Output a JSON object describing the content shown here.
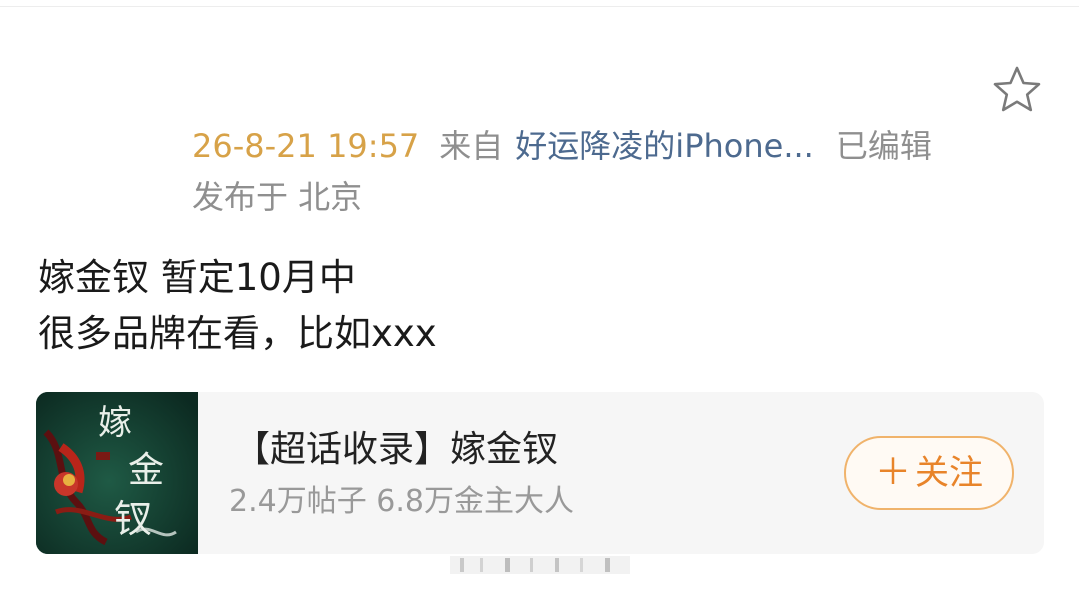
{
  "post_meta": {
    "time": "26-8-21 19:57",
    "from_label": "来自",
    "device": "好运降凌的iPhone...",
    "edited": "已编辑",
    "location": "发布于 北京"
  },
  "post": {
    "lines": [
      "嫁金钗 暂定10月中",
      "很多品牌在看，比如xxx"
    ]
  },
  "topic_card": {
    "title": "【超话收录】嫁金钗",
    "stats": "2.4万帖子 6.8万金主大人",
    "follow_label": "关注",
    "follow_icon": "plus-icon",
    "cover_lettering": "嫁金钗"
  },
  "icons": {
    "favorite": "star-outline-icon"
  },
  "colors": {
    "time": "#d7a248",
    "link": "#4d6a8f",
    "muted": "#8f8f8f",
    "follow": "#e8842a"
  }
}
